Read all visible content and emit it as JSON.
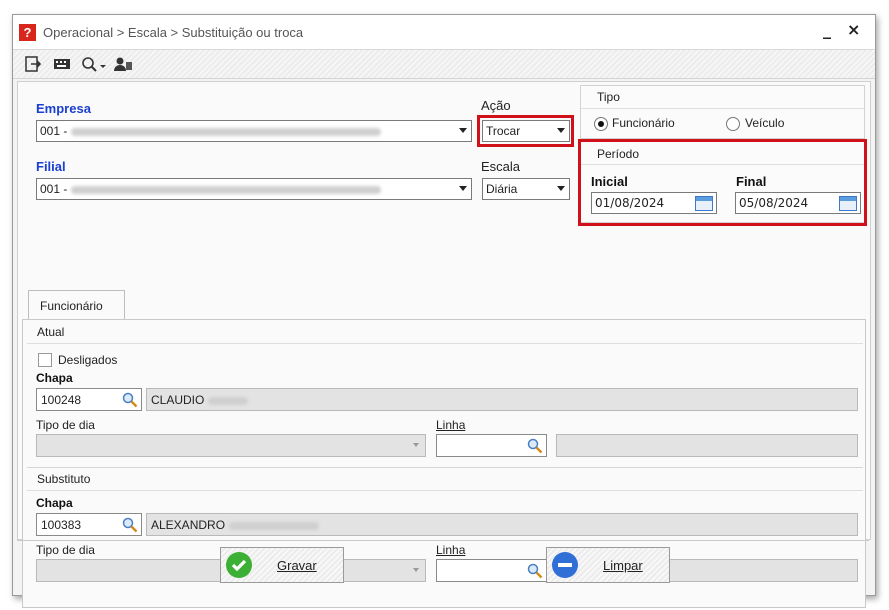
{
  "window": {
    "title": "Operacional > Escala > Substituição ou troca",
    "minimize": "_",
    "close": "×"
  },
  "form": {
    "empresa": {
      "label": "Empresa",
      "value": "001 -"
    },
    "filial": {
      "label": "Filial",
      "value": "001 -"
    },
    "acao": {
      "label": "Ação",
      "value": "Trocar"
    },
    "escala": {
      "label": "Escala",
      "value": "Diária"
    }
  },
  "tipo": {
    "title": "Tipo",
    "options": [
      "Funcionário",
      "Veículo"
    ],
    "selected": "Funcionário"
  },
  "periodo": {
    "title": "Período",
    "inicial_label": "Inicial",
    "inicial_value": "01/08/2024",
    "final_label": "Final",
    "final_value": "05/08/2024"
  },
  "tab": {
    "label": "Funcionário"
  },
  "atual": {
    "title": "Atual",
    "desligados_label": "Desligados",
    "chapa_label": "Chapa",
    "chapa_value": "100248",
    "name_value": "CLAUDIO",
    "tipo_dia_label": "Tipo de dia",
    "linha_label": "Linha"
  },
  "substituto": {
    "title": "Substituto",
    "chapa_label": "Chapa",
    "chapa_value": "100383",
    "name_value": "ALEXANDRO",
    "tipo_dia_label": "Tipo de dia",
    "linha_label": "Linha"
  },
  "buttons": {
    "gravar": "Gravar",
    "limpar": "Limpar"
  },
  "colors": {
    "highlight": "#d0101a",
    "label_blue": "#1a3fd1",
    "gravar_icon": "#3cb034",
    "limpar_icon": "#2f6fd6"
  }
}
